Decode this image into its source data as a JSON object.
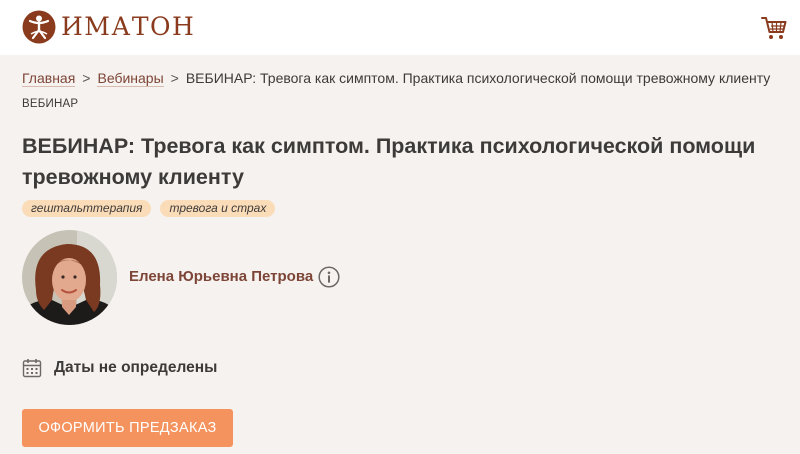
{
  "header": {
    "logo_text": "ИМАТОН",
    "logo_icon": "imaton-logo-icon",
    "cart_icon": "cart-icon"
  },
  "breadcrumb": {
    "items": [
      "Главная",
      "Вебинары"
    ],
    "separator": ">",
    "current": "ВЕБИНАР: Тревога как симптом. Практика психологической помощи тревожному клиенту"
  },
  "page": {
    "category": "ВЕБИНАР",
    "title": "ВЕБИНАР: Тревога как симптом. Практика психологической помощи тревожному клиенту",
    "tags": [
      "гештальттерапия",
      "тревога и страх"
    ]
  },
  "author": {
    "name": "Елена Юрьевна Петрова",
    "info_icon": "info-icon"
  },
  "dates": {
    "icon": "calendar-icon",
    "text": "Даты не определены"
  },
  "actions": {
    "order_label": "ОФОРМИТЬ ПРЕДЗАКАЗ"
  },
  "colors": {
    "background": "#f6f2ef",
    "brand": "#8a3b1d",
    "link": "#7d4537",
    "tag_bg": "#fbdcb8",
    "button_bg": "#f5935e"
  }
}
